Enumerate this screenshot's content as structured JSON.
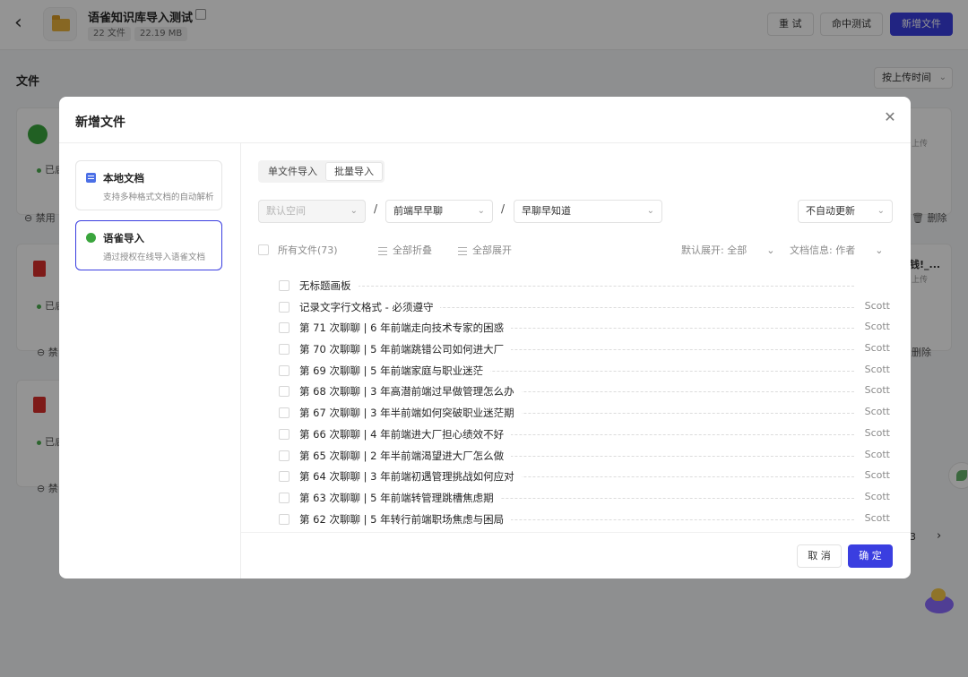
{
  "header": {
    "title": "语雀知识库导入测试",
    "file_count": "22 文件",
    "size": "22.19 MB",
    "buttons": {
      "retry": "重 试",
      "hit_test": "命中测试",
      "add_file": "新增文件"
    }
  },
  "files_section": {
    "label": "文件",
    "sort": "按上传时间"
  },
  "background_cards": {
    "enabled_label": "已启",
    "disable_label": "禁用",
    "disable_short": "禁",
    "delete_label": "删除",
    "upload_label": "上传",
    "truncated_title": "钱!_..."
  },
  "pager": {
    "page": "3"
  },
  "modal": {
    "title": "新增文件",
    "sources": [
      {
        "title": "本地文档",
        "desc": "支持多种格式文档的自动解析"
      },
      {
        "title": "语雀导入",
        "desc": "通过授权在线导入语雀文档"
      }
    ],
    "tabs": {
      "single": "单文件导入",
      "batch": "批量导入"
    },
    "selects": {
      "space_placeholder": "默认空间",
      "group": "前端早早聊",
      "repo": "早聊早知道",
      "update": "不自动更新",
      "separator": "/"
    },
    "toolbar": {
      "all_files": "所有文件(73)",
      "collapse_all": "全部折叠",
      "expand_all": "全部展开",
      "default_expand": "默认展开: 全部",
      "doc_info": "文档信息: 作者"
    },
    "files": [
      {
        "name": "无标题画板",
        "author": ""
      },
      {
        "name": "记录文字行文格式 - 必须遵守",
        "author": "Scott"
      },
      {
        "name": "第 71 次聊聊 | 6 年前端走向技术专家的困惑",
        "author": "Scott"
      },
      {
        "name": "第 70 次聊聊 | 5 年前端跳错公司如何进大厂",
        "author": "Scott"
      },
      {
        "name": "第 69 次聊聊 | 5 年前端家庭与职业迷茫",
        "author": "Scott"
      },
      {
        "name": "第 68 次聊聊 | 3 年高潜前端过早做管理怎么办",
        "author": "Scott"
      },
      {
        "name": "第 67 次聊聊 | 3 年半前端如何突破职业迷茫期",
        "author": "Scott"
      },
      {
        "name": "第 66 次聊聊 | 4 年前端进大厂担心绩效不好",
        "author": "Scott"
      },
      {
        "name": "第 65 次聊聊 | 2 年半前端渴望进大厂怎么做",
        "author": "Scott"
      },
      {
        "name": "第 64 次聊聊 | 3 年前端初遇管理挑战如何应对",
        "author": "Scott"
      },
      {
        "name": "第 63 次聊聊 | 5 年前端转管理跳槽焦虑期",
        "author": "Scott"
      },
      {
        "name": "第 62 次聊聊 | 5 年转行前端职场焦虑与困局",
        "author": "Scott"
      }
    ],
    "footer": {
      "cancel": "取 消",
      "ok": "确 定"
    }
  },
  "colors": {
    "primary": "#3a3ee0",
    "leaf": "#3aa53d",
    "pdf": "#d9302c"
  }
}
